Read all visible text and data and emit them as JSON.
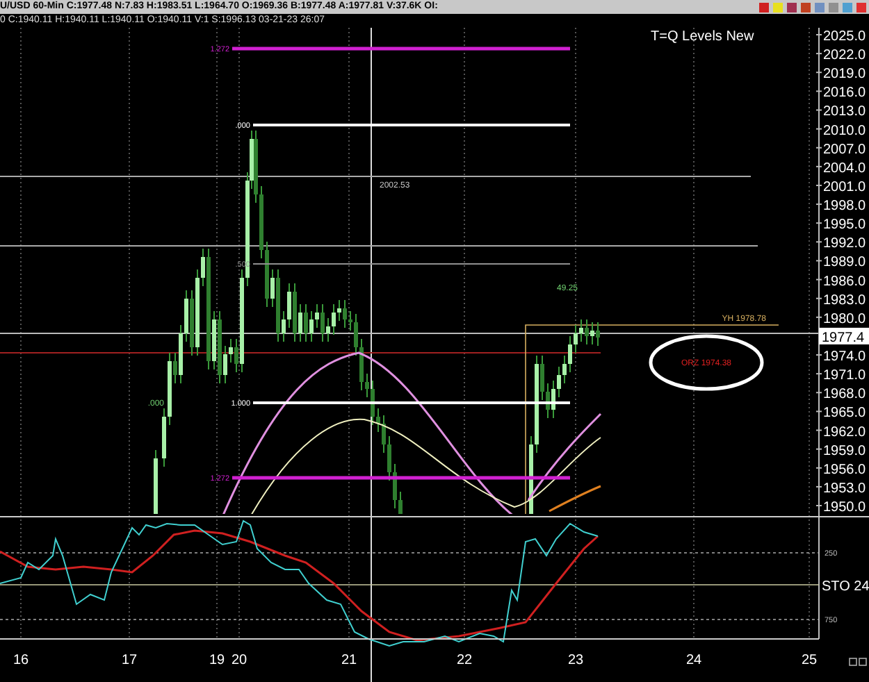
{
  "header": {
    "quote_line": "U/USD 60-Min C:1977.48 N:7.83 H:1983.51 L:1964.70 O:1969.36 B:1977.48 A:1977.81 V:37.6K OI:",
    "cursor_line": "0 C:1940.11 H:1940.11 L:1940.11 O:1940.11 V:1 S:1996.13 03-21-23 26:07"
  },
  "chart": {
    "title": "T=Q Levels New",
    "price_axis": [
      "2025.0",
      "2022.0",
      "2019.0",
      "2016.0",
      "2013.0",
      "2010.0",
      "2007.0",
      "2004.0",
      "2001.0",
      "1998.0",
      "1995.0",
      "1992.0",
      "1989.0",
      "1986.0",
      "1983.0",
      "1980.0",
      "1977.4",
      "1974.0",
      "1971.0",
      "1968.0",
      "1965.0",
      "1962.0",
      "1959.0",
      "1956.0",
      "1953.0",
      "1950.0"
    ],
    "fib_levels": [
      {
        "label": "1.272",
        "kind": "extension"
      },
      {
        "label": ".000",
        "kind": "retracement"
      },
      {
        "label": ".500",
        "kind": "midpoint"
      },
      {
        "label": "1.000",
        "kind": "retracement"
      },
      {
        "label": "1.272",
        "kind": "extension"
      }
    ],
    "labels": [
      {
        "text": "2002.53",
        "kind": "price"
      },
      {
        "text": "49.25",
        "kind": "peak"
      },
      {
        "text": ".000",
        "kind": "peak"
      },
      {
        "text": "YH 1978.78",
        "kind": "level"
      },
      {
        "text": "ORZ 1974.38",
        "kind": "circled"
      }
    ]
  },
  "oscillator": {
    "label": "STO 24",
    "levels": [
      "250",
      "750"
    ]
  },
  "date_axis": [
    "16",
    "17",
    "19",
    "20",
    "21",
    "22",
    "23",
    "24",
    "25"
  ]
}
